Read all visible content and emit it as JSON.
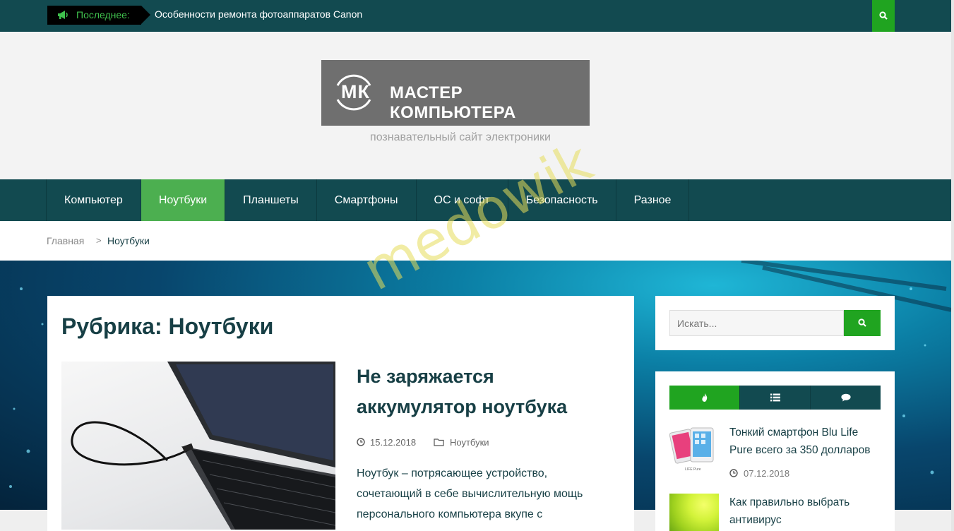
{
  "topbar": {
    "latest_label": "Последнее:",
    "ticker_text": "Особенности ремонта фотоаппаратов Canon"
  },
  "header": {
    "logo_mark": "МК",
    "logo_name": "МАСТЕР КОМПЬЮТЕРА",
    "tagline": "познавательный сайт электроники"
  },
  "nav": {
    "items": [
      {
        "label": "Компьютер"
      },
      {
        "label": "Ноутбуки"
      },
      {
        "label": "Планшеты"
      },
      {
        "label": "Смартфоны"
      },
      {
        "label": "ОС и софт"
      },
      {
        "label": "Безопасность"
      },
      {
        "label": "Разное"
      }
    ],
    "active_index": 1
  },
  "breadcrumb": {
    "home": "Главная",
    "separator": ">",
    "current": "Ноутбуки"
  },
  "watermark": "medowik",
  "archive": {
    "title": "Рубрика: Ноутбуки"
  },
  "post": {
    "title": "Не заряжается аккумулятор ноутбука",
    "date": "15.12.2018",
    "category": "Ноутбуки",
    "excerpt": "Ноутбук – потрясающее устройство, сочетающий в себе вычислительную мощь персонального компьютера вкупе с"
  },
  "sidebar": {
    "search_placeholder": "Искать...",
    "tabs": [
      {
        "icon": "fire-icon"
      },
      {
        "icon": "list-icon"
      },
      {
        "icon": "comment-icon"
      }
    ],
    "active_tab": 0,
    "posts": [
      {
        "title": "Тонкий смартфон Blu Life Pure всего за 350 долларов",
        "date": "07.12.2018",
        "thumb_caption": "LIFE Pure"
      },
      {
        "title": "Как правильно выбрать антивирус"
      }
    ]
  },
  "colors": {
    "primary_dark": "#124a50",
    "accent_green": "#20a420",
    "nav_active": "#4caf50",
    "text_dark": "#173f45"
  }
}
